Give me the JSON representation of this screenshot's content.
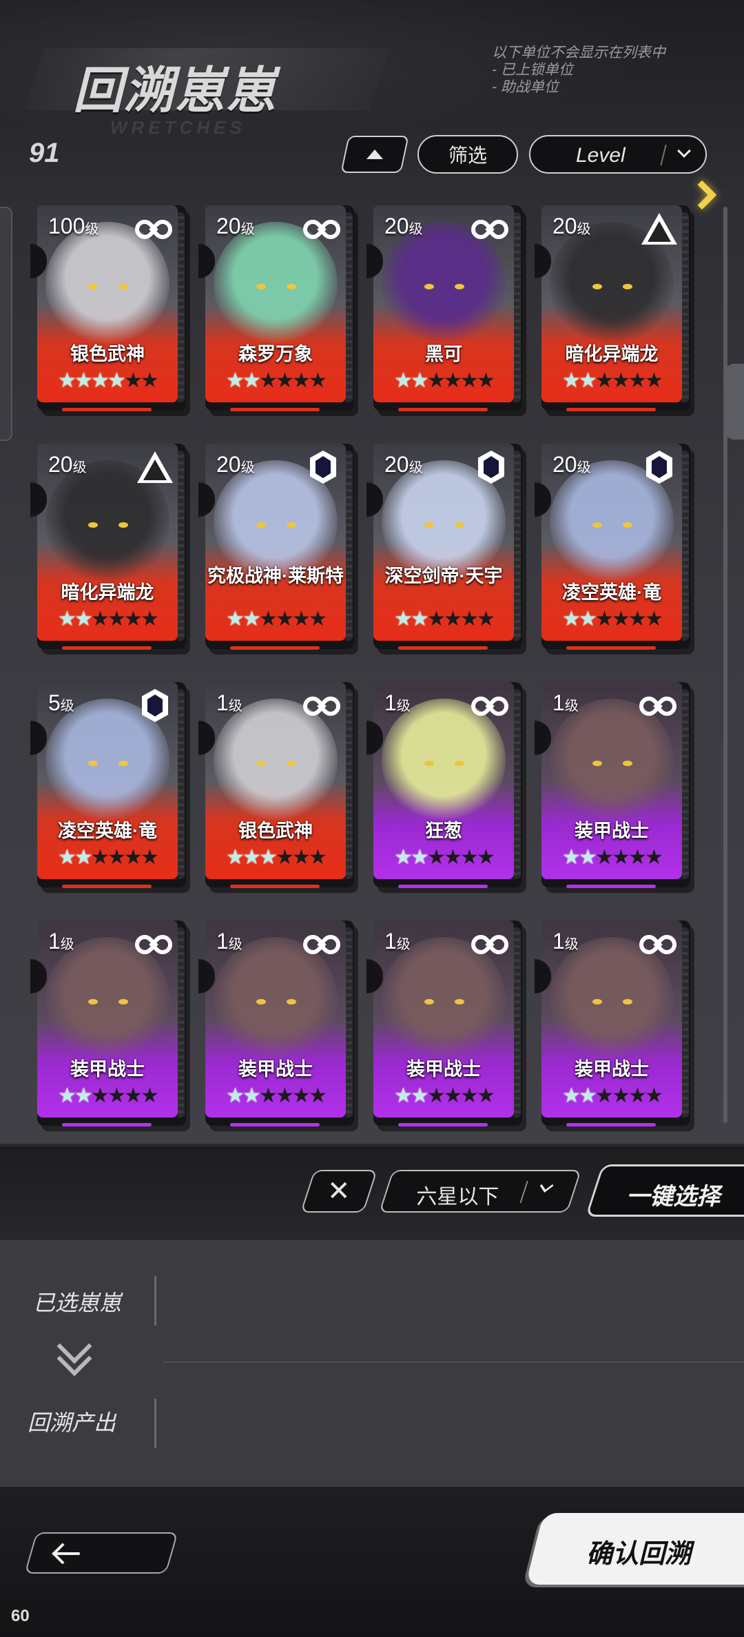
{
  "header": {
    "title": "回溯崽崽",
    "title_sub": "WRETCHES",
    "notice_lines": [
      "以下单位不会显示在列表中",
      "- 已上锁单位",
      "- 助战单位"
    ]
  },
  "toolbar": {
    "count": "91",
    "filter_label": "筛选",
    "sort_select_value": "Level"
  },
  "cards": [
    {
      "level": "100",
      "level_unit": "级",
      "name": "银色武神",
      "icon": "infinity-icon",
      "stars": 4,
      "rarity": "red",
      "art": "#cfcfd4"
    },
    {
      "level": "20",
      "level_unit": "级",
      "name": "森罗万象",
      "icon": "infinity-icon",
      "stars": 2,
      "rarity": "red",
      "art": "#7fd6b0"
    },
    {
      "level": "20",
      "level_unit": "级",
      "name": "黑可",
      "icon": "infinity-icon",
      "stars": 2,
      "rarity": "red",
      "art": "#5b2b8c"
    },
    {
      "level": "20",
      "level_unit": "级",
      "name": "暗化异端龙",
      "icon": "triangle-icon",
      "stars": 2,
      "rarity": "red",
      "art": "#2e2e30"
    },
    {
      "level": "20",
      "level_unit": "级",
      "name": "暗化异端龙",
      "icon": "triangle-icon",
      "stars": 2,
      "rarity": "red",
      "art": "#2e2e30"
    },
    {
      "level": "20",
      "level_unit": "级",
      "name": "究极战神·莱斯特",
      "icon": "hexagon-icon",
      "stars": 2,
      "rarity": "red",
      "art": "#b9c4e6"
    },
    {
      "level": "20",
      "level_unit": "级",
      "name": "深空剑帝·天宇",
      "icon": "hexagon-icon",
      "stars": 2,
      "rarity": "red",
      "art": "#c9d4ee"
    },
    {
      "level": "20",
      "level_unit": "级",
      "name": "凌空英雄·竜",
      "icon": "hexagon-icon",
      "stars": 2,
      "rarity": "red",
      "art": "#a9b7e0"
    },
    {
      "level": "5",
      "level_unit": "级",
      "name": "凌空英雄·竜",
      "icon": "hexagon-icon",
      "stars": 2,
      "rarity": "red",
      "art": "#a9b7e0"
    },
    {
      "level": "1",
      "level_unit": "级",
      "name": "银色武神",
      "icon": "infinity-icon",
      "stars": 3,
      "rarity": "red",
      "art": "#cfcfd4"
    },
    {
      "level": "1",
      "level_unit": "级",
      "name": "狂葱",
      "icon": "infinity-icon",
      "stars": 2,
      "rarity": "purple",
      "art": "#e7ee9a"
    },
    {
      "level": "1",
      "level_unit": "级",
      "name": "装甲战士",
      "icon": "infinity-icon",
      "stars": 2,
      "rarity": "purple",
      "art": "#7a5c5e"
    },
    {
      "level": "1",
      "level_unit": "级",
      "name": "装甲战士",
      "icon": "infinity-icon",
      "stars": 2,
      "rarity": "purple",
      "art": "#7a5c5e"
    },
    {
      "level": "1",
      "level_unit": "级",
      "name": "装甲战士",
      "icon": "infinity-icon",
      "stars": 2,
      "rarity": "purple",
      "art": "#7a5c5e"
    },
    {
      "level": "1",
      "level_unit": "级",
      "name": "装甲战士",
      "icon": "infinity-icon",
      "stars": 2,
      "rarity": "purple",
      "art": "#7a5c5e"
    },
    {
      "level": "1",
      "level_unit": "级",
      "name": "装甲战士",
      "icon": "infinity-icon",
      "stars": 2,
      "rarity": "purple",
      "art": "#7a5c5e"
    }
  ],
  "card_max_stars": 6,
  "action_bar": {
    "clear_symbol": "✕",
    "star_filter_value": "六星以下",
    "one_click_label": "一键选择"
  },
  "selection": {
    "selected_label": "已选崽崽",
    "output_label": "回溯产出"
  },
  "footer": {
    "confirm_label": "确认回溯",
    "fps": "60"
  },
  "colors": {
    "accent_yellow": "#f3d14a",
    "rarity_red": "#e72d18",
    "rarity_purple": "#b230ea",
    "star_active": "#bfeee8"
  }
}
